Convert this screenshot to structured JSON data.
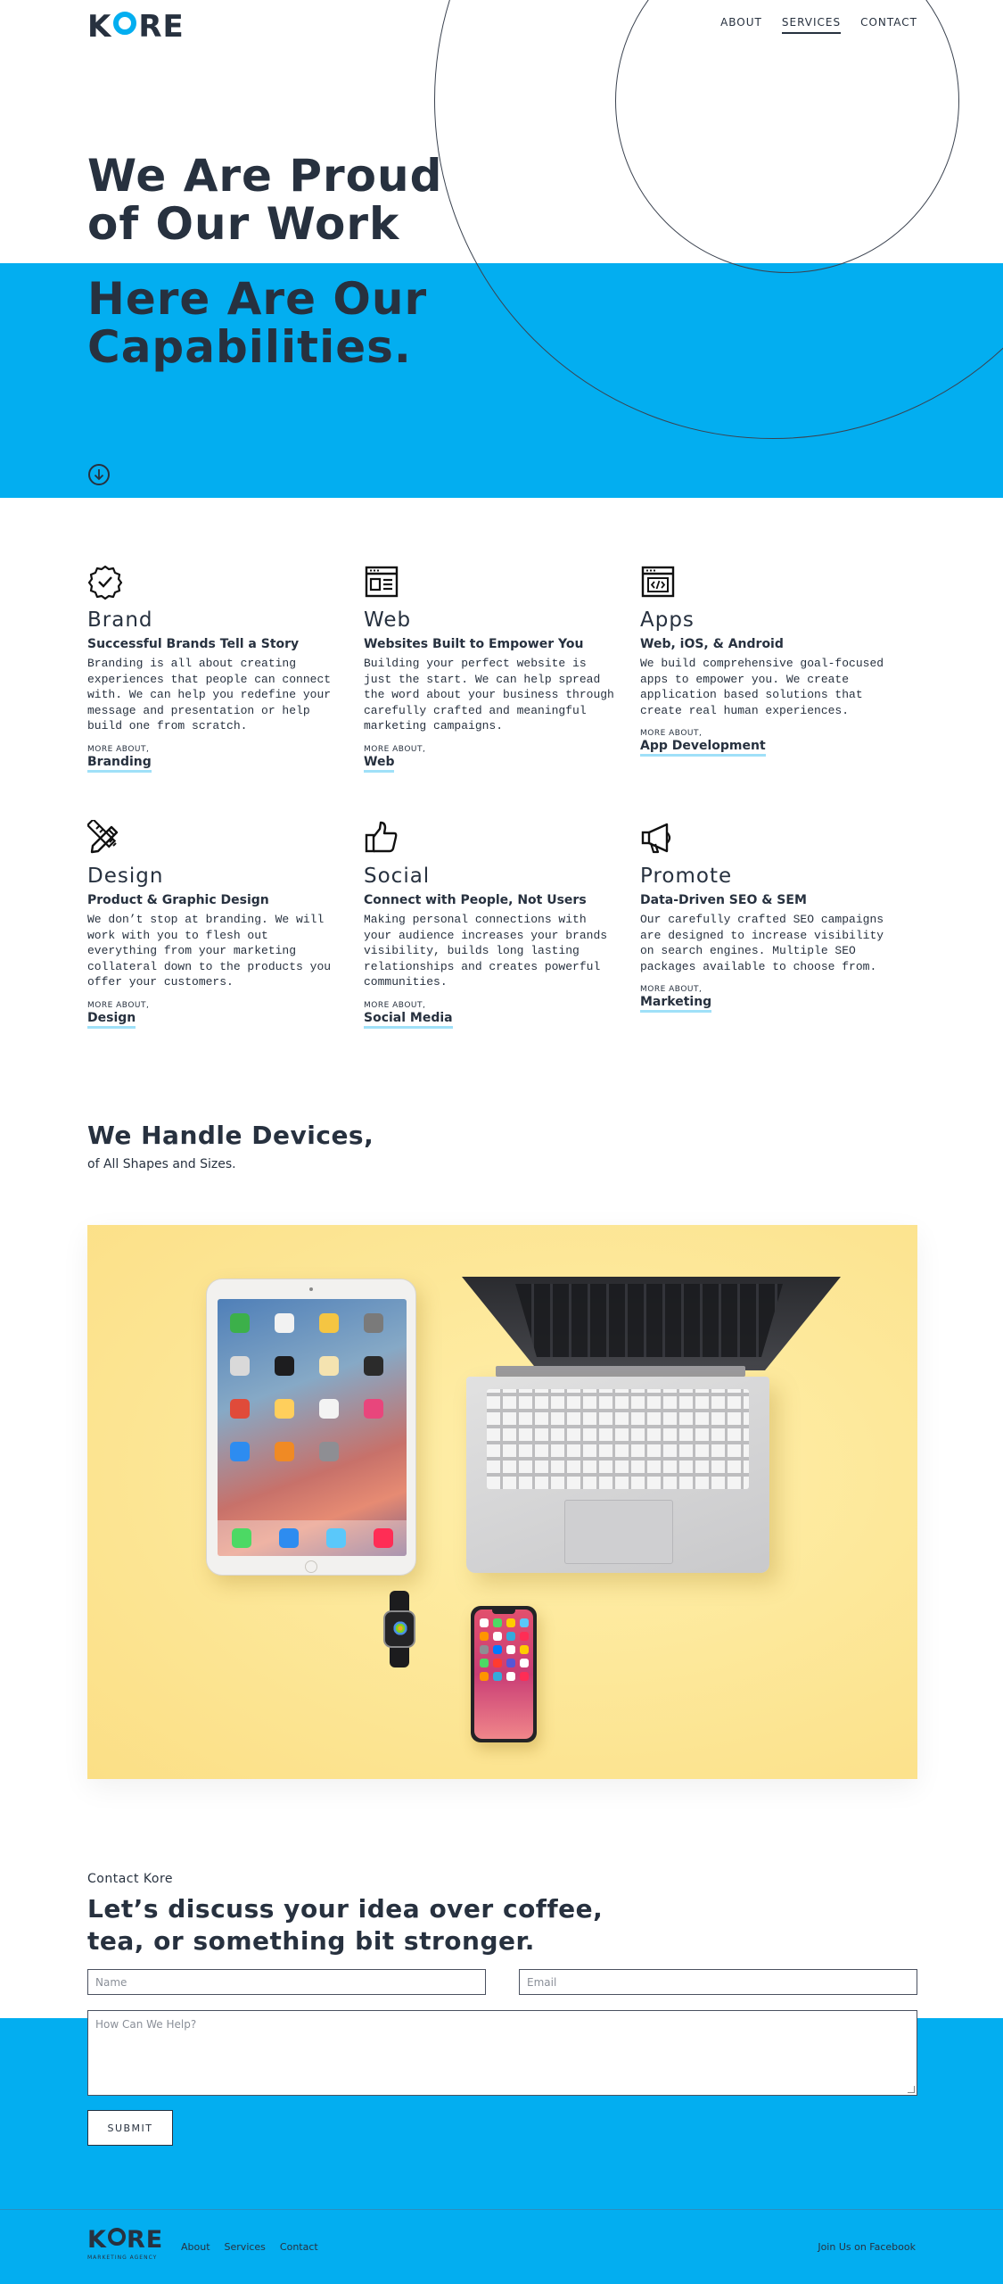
{
  "header": {
    "logo_text_left": "K",
    "logo_text_right": "RE",
    "nav": [
      {
        "label": "ABOUT",
        "active": false
      },
      {
        "label": "SERVICES",
        "active": true
      },
      {
        "label": "CONTACT",
        "active": false
      }
    ]
  },
  "hero": {
    "title": "We Are Proud of Our Work",
    "subtitle": "Here Are Our Capabilities.",
    "scroll_icon": "arrow-down-circle-icon"
  },
  "colors": {
    "accent_blue": "#03aef0",
    "text_dark": "#27313f",
    "link_underline": "#9fe0f8"
  },
  "services": [
    {
      "icon": "badge-check-icon",
      "title": "Brand",
      "subtitle": "Successful Brands Tell a Story",
      "description": "Branding is all about creating experiences that people can connect with. We can help you redefine your message and presentation or help build one from scratch.",
      "more_label": "MORE ABOUT,",
      "link": "Branding"
    },
    {
      "icon": "browser-window-icon",
      "title": "Web",
      "subtitle": "Websites Built to Empower You",
      "description": "Building your perfect website is just the start. We can help spread the word about your business through carefully crafted and meaningful marketing campaigns.",
      "more_label": "MORE ABOUT,",
      "link": "Web"
    },
    {
      "icon": "code-window-icon",
      "title": "Apps",
      "subtitle": "Web, iOS, & Android",
      "description": "We build comprehensive goal-focused apps to empower you. We create application based solutions that create real human experiences.",
      "more_label": "MORE ABOUT,",
      "link": "App Development"
    },
    {
      "icon": "pencil-ruler-icon",
      "title": "Design",
      "subtitle": "Product & Graphic Design",
      "description": "We don’t stop at branding. We will work with you to flesh out everything from your marketing collateral down to the products you offer your customers.",
      "more_label": "MORE ABOUT,",
      "link": "Design"
    },
    {
      "icon": "thumbs-up-icon",
      "title": "Social",
      "subtitle": "Connect with People, Not Users",
      "description": "Making personal connections with your audience increases your brands visibility, builds long lasting relationships and creates powerful communities.",
      "more_label": "MORE ABOUT,",
      "link": "Social Media"
    },
    {
      "icon": "megaphone-icon",
      "title": "Promote",
      "subtitle": "Data-Driven SEO & SEM",
      "description": "Our carefully crafted SEO campaigns are designed to increase visibility on search engines. Multiple SEO packages available to choose from.",
      "more_label": "MORE ABOUT,",
      "link": "Marketing"
    }
  ],
  "devices": {
    "title": "We Handle Devices,",
    "subtitle": "of All Shapes and Sizes."
  },
  "contact": {
    "label": "Contact Kore",
    "title": "Let’s discuss your idea over coffee, tea, or something bit stronger.",
    "name_placeholder": "Name",
    "email_placeholder": "Email",
    "message_placeholder": "How Can We Help?",
    "submit_label": "SUBMIT"
  },
  "footer": {
    "logo_left": "K",
    "logo_right": "RE",
    "tagline": "MARKETING AGENCY",
    "nav": [
      "About",
      "Services",
      "Contact"
    ],
    "facebook": "Join Us on Facebook"
  }
}
